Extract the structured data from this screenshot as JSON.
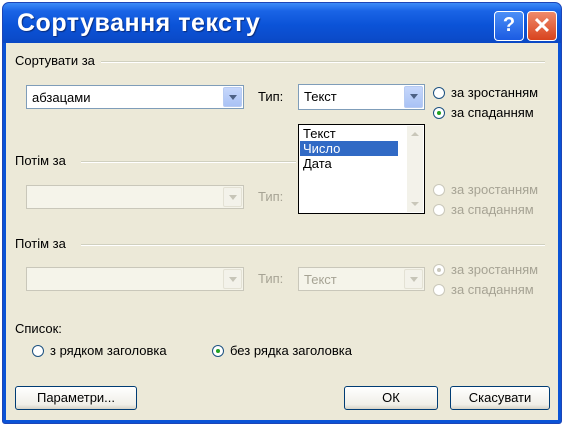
{
  "window": {
    "title": "Сортування тексту",
    "help_glyph": "?",
    "close_glyph": "✕"
  },
  "sort1": {
    "group_label": "Сортувати за",
    "field_value": "абзацами",
    "type_label": "Тип:",
    "type_value": "Текст",
    "asc_label": "за зростанням",
    "desc_label": "за спаданням",
    "selected_order": "desc"
  },
  "type_dropdown": {
    "options": [
      "Текст",
      "Число",
      "Дата"
    ],
    "highlighted": "Число"
  },
  "sort2": {
    "group_label": "Потім за",
    "field_value": "",
    "type_label": "Тип:",
    "asc_label": "за зростанням",
    "desc_label": "за спаданням"
  },
  "sort3": {
    "group_label": "Потім за",
    "field_value": "",
    "type_label": "Тип:",
    "type_value": "Текст",
    "asc_label": "за зростанням",
    "desc_label": "за спаданням"
  },
  "list": {
    "label": "Список:",
    "with_header": "з рядком заголовка",
    "without_header": "без рядка заголовка",
    "selected": "without_header"
  },
  "buttons": {
    "params": "Параметри...",
    "ok": "ОК",
    "cancel": "Скасувати"
  },
  "colors": {
    "titlebar": "#0b53d8",
    "dialog_bg": "#ece9d8",
    "selection": "#316ac5"
  }
}
